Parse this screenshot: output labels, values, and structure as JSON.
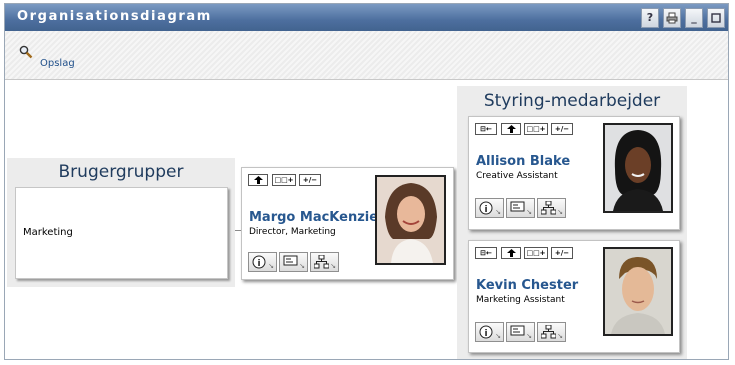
{
  "window": {
    "title": "Organisationsdiagram",
    "title_buttons": [
      "?",
      "print",
      "minimize",
      "maximize"
    ]
  },
  "toolbar": {
    "lookup_label": "Opslag"
  },
  "groups_panel": {
    "title": "Brugergrupper",
    "items": [
      "Marketing"
    ]
  },
  "center_person": {
    "name": "Margo MacKenzie",
    "title": "Director, Marketing",
    "nav_buttons": [
      "up",
      "show-reports",
      "expand-collapse"
    ],
    "actions": [
      "info",
      "email",
      "org-chart"
    ]
  },
  "reports_panel": {
    "title": "Styring-medarbejder",
    "people": [
      {
        "name": "Allison Blake",
        "title": "Creative Assistant",
        "nav_buttons": [
          "back-to-manager",
          "up",
          "show-reports",
          "expand-collapse"
        ],
        "actions": [
          "info",
          "email",
          "org-chart"
        ]
      },
      {
        "name": "Kevin Chester",
        "title": "Marketing Assistant",
        "nav_buttons": [
          "back-to-manager",
          "up",
          "show-reports",
          "expand-collapse"
        ],
        "actions": [
          "info",
          "email",
          "org-chart"
        ]
      }
    ]
  },
  "colors": {
    "titlebar": "#4d6f9f",
    "name_link": "#27578f",
    "group_title": "#203c5e"
  }
}
